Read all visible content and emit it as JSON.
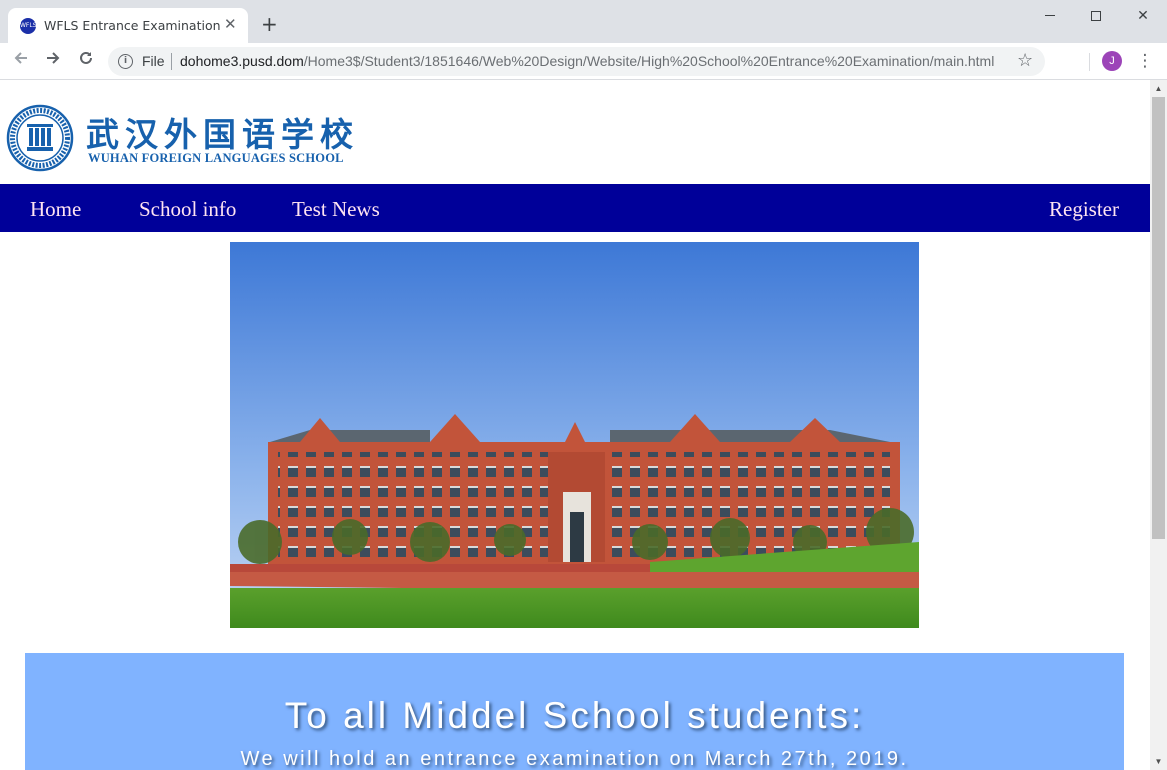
{
  "browser": {
    "tab_title": "WFLS Entrance Examination",
    "tab_favicon_text": "WFLS",
    "close_tab_glyph": "✕",
    "new_tab_glyph": "+",
    "file_label": "File",
    "url_host": "dohome3.pusd.dom",
    "url_path": "/Home3$/Student3/1851646/Web%20Design/Website/High%20School%20Entrance%20Examination/main.html",
    "profile_initial": "J",
    "icons": [
      "back-arrow-icon",
      "forward-arrow-icon",
      "reload-icon",
      "info-icon",
      "star-icon",
      "kebab-menu-icon"
    ]
  },
  "logo": {
    "chinese_name": "武汉外国语学校",
    "english_name": "WUHAN FOREIGN LANGUAGES SCHOOL",
    "colors": {
      "brand_blue": "#1761ad"
    }
  },
  "nav": {
    "home": "Home",
    "school_info": "School info",
    "test_news": "Test News",
    "register": "Register",
    "colors": {
      "bar": "#000099",
      "link": "#ffe4f2"
    }
  },
  "hero": {
    "alt": "Wuhan Foreign Languages School red-brick campus building under blue sky"
  },
  "announcement": {
    "title": "To all Middel School students:",
    "body": "We will hold an entrance examination on March 27th, 2019.",
    "colors": {
      "background": "#80b3ff",
      "text": "#ffffff"
    }
  }
}
